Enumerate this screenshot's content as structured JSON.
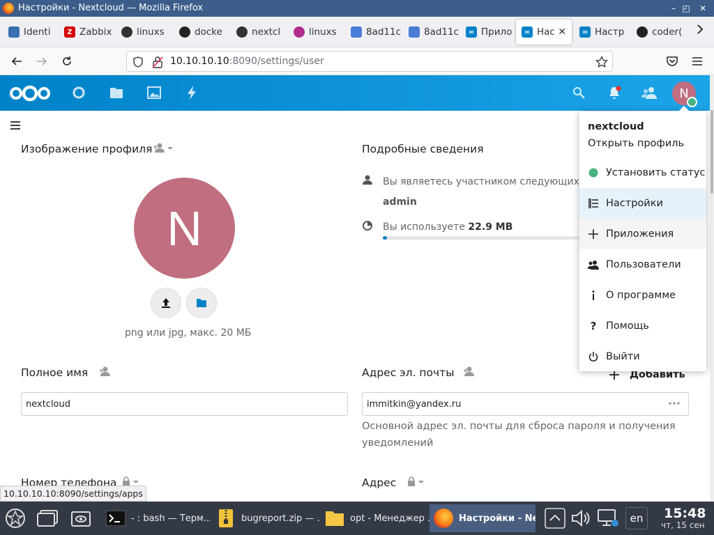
{
  "window": {
    "title": "Настройки - Nextcloud — Mozilla Firefox"
  },
  "tabs": [
    {
      "label": "Identi",
      "icon": "box-icon",
      "color": "#3a6fb0"
    },
    {
      "label": "Zabbix",
      "icon": "zabbix-icon",
      "color": "#d40000"
    },
    {
      "label": "linuxs",
      "icon": "linux-icon",
      "color": "#333"
    },
    {
      "label": "docke",
      "icon": "github-icon",
      "color": "#222"
    },
    {
      "label": "nextcl",
      "icon": "linux-icon",
      "color": "#333"
    },
    {
      "label": "linuxs",
      "icon": "globe-icon",
      "color": "#b02d8b"
    },
    {
      "label": "8ad11c",
      "icon": "link-icon",
      "color": "#4a7dd6"
    },
    {
      "label": "8ad11c",
      "icon": "link-icon",
      "color": "#4a7dd6"
    },
    {
      "label": "Прило",
      "icon": "nextcloud-icon",
      "color": "#0082c9"
    },
    {
      "label": "Нас",
      "icon": "nextcloud-icon",
      "color": "#0082c9",
      "active": true
    },
    {
      "label": "Настр",
      "icon": "nextcloud-icon",
      "color": "#0082c9"
    },
    {
      "label": "coder(",
      "icon": "github-icon",
      "color": "#222"
    }
  ],
  "url": {
    "host": "10.10.10.10",
    "path": ":8090/settings/user"
  },
  "profile": {
    "picture_heading": "Изображение профиля",
    "initial": "N",
    "format_hint": "png или jpg, макс. 20 МБ",
    "details_heading": "Подробные сведения",
    "member_text": "Вы являетесь участником следующих г",
    "group": "admin",
    "usage_prefix": "Вы используете ",
    "usage_value": "22.9 MB",
    "usage_fraction": 0.02
  },
  "fields": {
    "fullname_label": "Полное имя",
    "fullname_value": "nextcloud",
    "email_label": "Адрес эл. почты",
    "add_label": "Добавить",
    "email_value": "immitkin@yandex.ru",
    "email_hint_1": "Основной адрес эл. почты для сброса пароля и получения",
    "email_hint_2": "уведомлений",
    "phone_label": "Номер телефона",
    "address_label": "Адрес"
  },
  "menu": {
    "username": "nextcloud",
    "open_profile": "Открыть профиль",
    "items": [
      {
        "label": "Установить статус",
        "icon": "status-dot-icon"
      },
      {
        "label": "Настройки",
        "icon": "settings-list-icon",
        "state": "highlighted"
      },
      {
        "label": "Приложения",
        "icon": "plus-icon",
        "state": "hover"
      },
      {
        "label": "Пользователи",
        "icon": "users-icon"
      },
      {
        "label": "О программе",
        "icon": "info-icon"
      },
      {
        "label": "Помощь",
        "icon": "help-icon"
      },
      {
        "label": "Выйти",
        "icon": "power-icon"
      }
    ]
  },
  "status_link": "10.10.10.10:8090/settings/apps",
  "taskbar": {
    "windows": [
      {
        "label": "- : bash — Терм...",
        "icon": "terminal-icon"
      },
      {
        "label": "bugreport.zip — ...",
        "icon": "archive-icon"
      },
      {
        "label": "opt - Менеджер ...",
        "icon": "folder-icon"
      },
      {
        "label": "Настройки - Ne...",
        "icon": "firefox-icon",
        "active": true
      }
    ],
    "lang": "en",
    "time": "15:48",
    "date": "чт, 15 сен"
  },
  "colors": {
    "brand": "#0082c9",
    "avatar": "#c16e80",
    "status_online": "#49b382",
    "taskbar": "#333a45"
  }
}
